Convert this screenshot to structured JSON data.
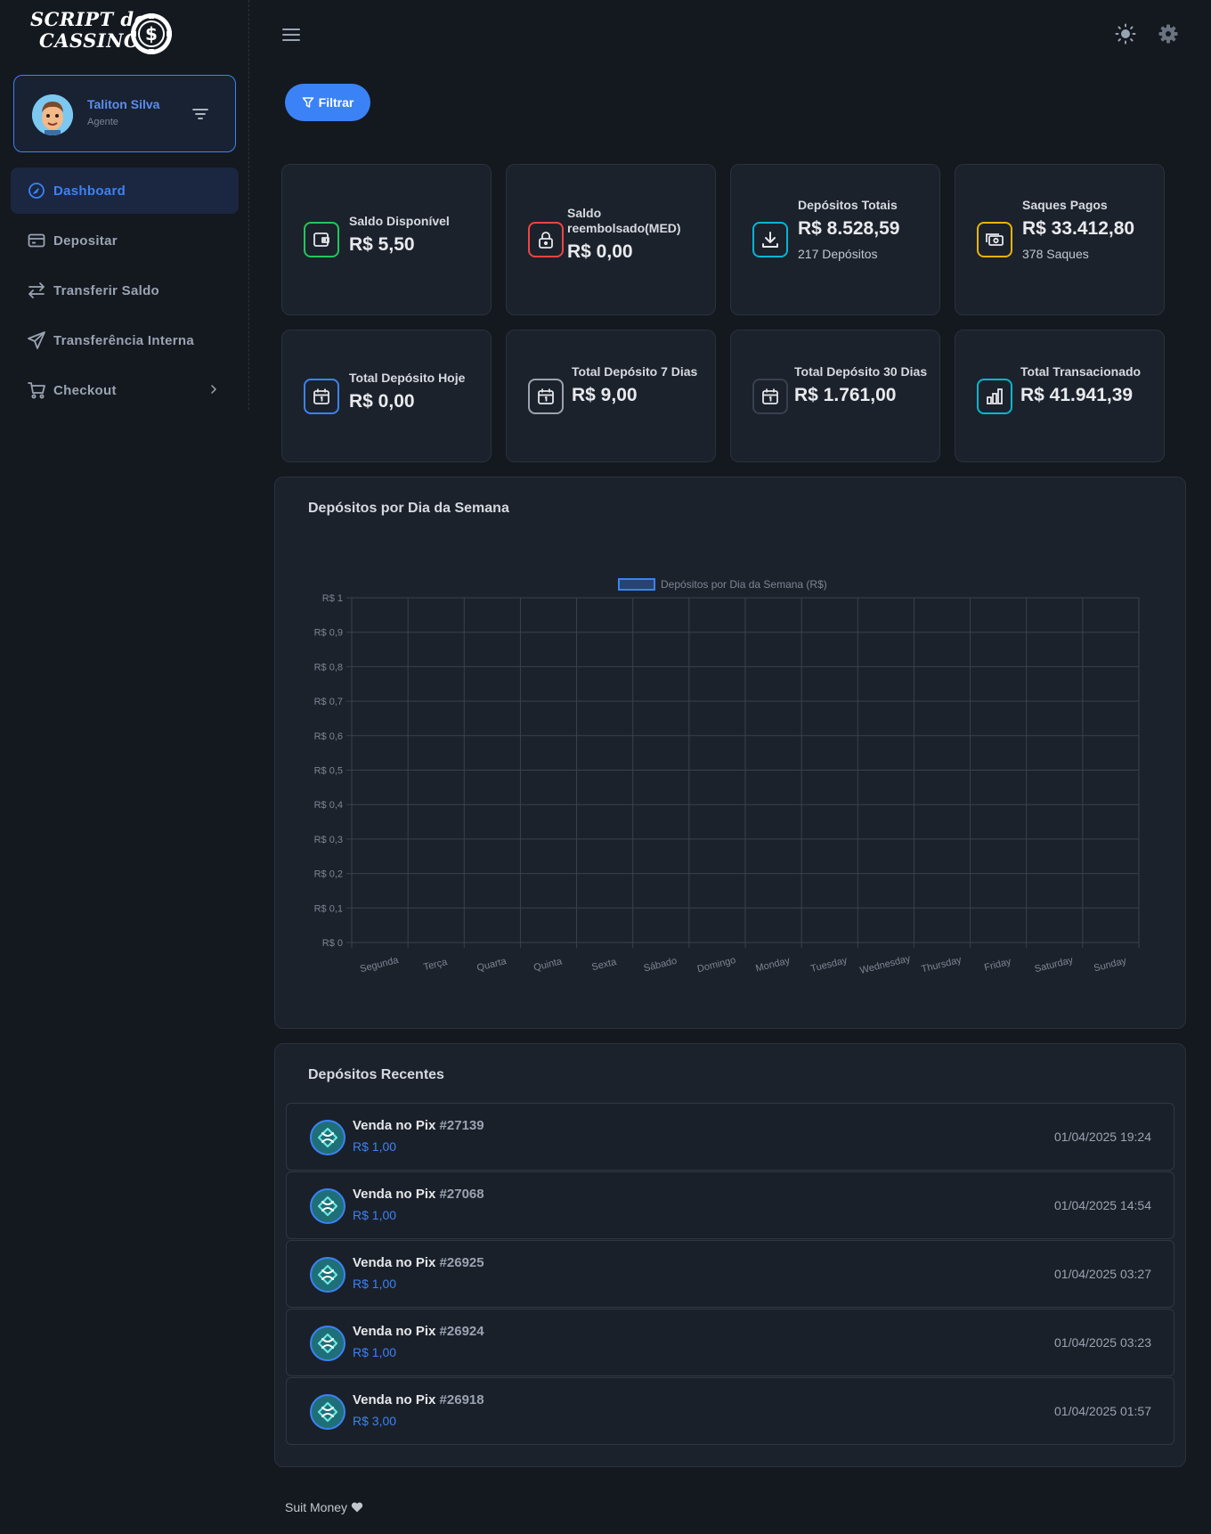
{
  "brand": {
    "line1": "SCRIPT de",
    "line2": "CASSINO",
    "chip_symbol": "$"
  },
  "user": {
    "name": "Taliton Silva",
    "role": "Agente"
  },
  "nav": [
    {
      "label": "Dashboard",
      "icon": "dashboard-icon",
      "active": true
    },
    {
      "label": "Depositar",
      "icon": "card-icon"
    },
    {
      "label": "Transferir Saldo",
      "icon": "transfer-icon"
    },
    {
      "label": "Transferência Interna",
      "icon": "send-icon"
    },
    {
      "label": "Checkout",
      "icon": "cart-icon",
      "has_submenu": true
    }
  ],
  "toolbar": {
    "filter_label": "Filtrar"
  },
  "stats": [
    {
      "title": "Saldo Disponível",
      "value": "R$ 5,50",
      "color": "#22c55e",
      "icon": "wallet-icon"
    },
    {
      "title": "Saldo reembolsado(MED)",
      "value": "R$ 0,00",
      "color": "#ef4444",
      "icon": "lock-icon"
    },
    {
      "title": "Depósitos Totais",
      "value": "R$ 8.528,59",
      "sub": "217 Depósitos",
      "color": "#06b6d4",
      "icon": "download-icon"
    },
    {
      "title": "Saques Pagos",
      "value": "R$ 33.412,80",
      "sub": "378 Saques",
      "color": "#eab308",
      "icon": "cash-icon"
    },
    {
      "title": "Total Depósito Hoje",
      "value": "R$ 0,00",
      "color": "#3b82f6",
      "icon": "calendar-icon"
    },
    {
      "title": "Total Depósito 7 Dias",
      "value": "R$ 9,00",
      "color": "#9ca3af",
      "icon": "calendar-icon"
    },
    {
      "title": "Total Depósito 30 Dias",
      "value": "R$ 1.761,00",
      "color": "#4b5563",
      "icon": "calendar-icon"
    },
    {
      "title": "Total Transacionado",
      "value": "R$ 41.941,39",
      "color": "#06b6d4",
      "icon": "bar-chart-icon"
    }
  ],
  "chart_title": "Depósitos por Dia da Semana",
  "chart_data": {
    "type": "bar",
    "categories": [
      "Segunda",
      "Terça",
      "Quarta",
      "Quinta",
      "Sexta",
      "Sábado",
      "Domingo",
      "Monday",
      "Tuesday",
      "Wednesday",
      "Thursday",
      "Friday",
      "Saturday",
      "Sunday"
    ],
    "series": [
      {
        "name": "Depósitos por Dia da Semana (R$)",
        "values": [
          0,
          0,
          0,
          0,
          0,
          0,
          0,
          0,
          0,
          0,
          0,
          0,
          0,
          0
        ],
        "color": "#3b82f6"
      }
    ],
    "y_ticks": [
      "R$ 0",
      "R$ 0,1",
      "R$ 0,2",
      "R$ 0,3",
      "R$ 0,4",
      "R$ 0,5",
      "R$ 0,6",
      "R$ 0,7",
      "R$ 0,8",
      "R$ 0,9",
      "R$ 1"
    ],
    "ylim": [
      0,
      1
    ],
    "grid": true,
    "legend": "top-center"
  },
  "recent": {
    "title": "Depósitos Recentes",
    "items": [
      {
        "label": "Venda no Pix",
        "id": "#27139",
        "amount": "R$ 1,00",
        "date": "01/04/2025 19:24"
      },
      {
        "label": "Venda no Pix",
        "id": "#27068",
        "amount": "R$ 1,00",
        "date": "01/04/2025 14:54"
      },
      {
        "label": "Venda no Pix",
        "id": "#26925",
        "amount": "R$ 1,00",
        "date": "01/04/2025 03:27"
      },
      {
        "label": "Venda no Pix",
        "id": "#26924",
        "amount": "R$ 1,00",
        "date": "01/04/2025 03:23"
      },
      {
        "label": "Venda no Pix",
        "id": "#26918",
        "amount": "R$ 3,00",
        "date": "01/04/2025 01:57"
      }
    ]
  },
  "footer": {
    "text": "Suit Money",
    "icon": "heart-icon"
  },
  "colors": {
    "accent": "#3b82f6",
    "background": "#141920",
    "card": "#1c222b"
  }
}
